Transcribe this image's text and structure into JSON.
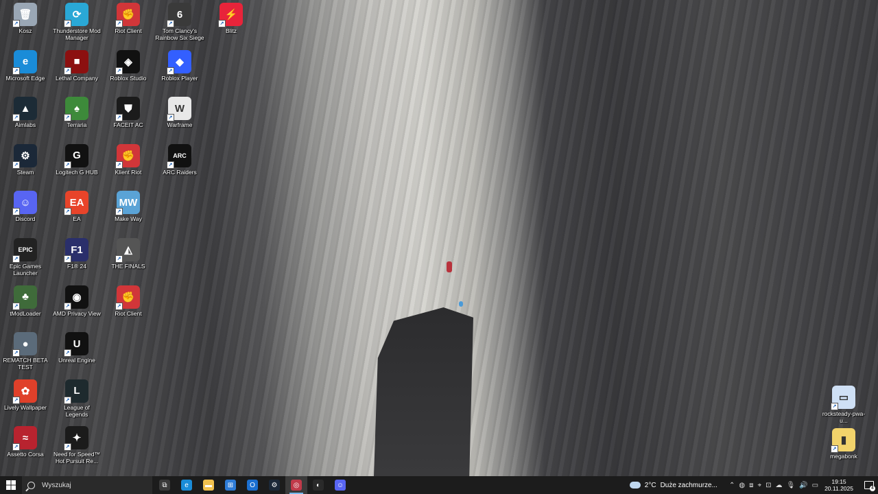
{
  "desktop_icons": [
    {
      "label": "Kosz",
      "icon": "recycle-bin-icon",
      "color": "#9aa7b5",
      "glyph": "🗑"
    },
    {
      "label": "Microsoft Edge",
      "icon": "edge-icon",
      "color": "#1a8cd8",
      "glyph": "e"
    },
    {
      "label": "Aimlabs",
      "icon": "aimlabs-icon",
      "color": "#1c2b36",
      "glyph": "▲"
    },
    {
      "label": "Steam",
      "icon": "steam-icon",
      "color": "#1b2838",
      "glyph": "⚙"
    },
    {
      "label": "Discord",
      "icon": "discord-icon",
      "color": "#5865f2",
      "glyph": "☺"
    },
    {
      "label": "Epic Games Launcher",
      "icon": "epic-games-icon",
      "color": "#222222",
      "glyph": "EPIC"
    },
    {
      "label": "tModLoader",
      "icon": "tmodloader-icon",
      "color": "#3f6b3a",
      "glyph": "♣"
    },
    {
      "label": "REMATCH BETA TEST",
      "icon": "rematch-icon",
      "color": "#5b6b7a",
      "glyph": "●"
    },
    {
      "label": "Lively Wallpaper",
      "icon": "lively-wallpaper-icon",
      "color": "#e0402a",
      "glyph": "✿"
    },
    {
      "label": "Assetto Corsa",
      "icon": "assetto-corsa-icon",
      "color": "#b8232f",
      "glyph": "≈"
    },
    {
      "label": "Thunderstore Mod Manager",
      "icon": "thunderstore-icon",
      "color": "#2aa8d6",
      "glyph": "⟳"
    },
    {
      "label": "Lethal Company",
      "icon": "lethal-company-icon",
      "color": "#8c1010",
      "glyph": "■"
    },
    {
      "label": "Terraria",
      "icon": "terraria-icon",
      "color": "#3d8a3a",
      "glyph": "♠"
    },
    {
      "label": "Logitech G HUB",
      "icon": "logitech-ghub-icon",
      "color": "#111111",
      "glyph": "G"
    },
    {
      "label": "EA",
      "icon": "ea-icon",
      "color": "#e8442a",
      "glyph": "EA"
    },
    {
      "label": "F1® 24",
      "icon": "f1-24-icon",
      "color": "#2a2f6b",
      "glyph": "F1"
    },
    {
      "label": "AMD Privacy View",
      "icon": "amd-privacy-view-icon",
      "color": "#111111",
      "glyph": "◉"
    },
    {
      "label": "Unreal Engine",
      "icon": "unreal-engine-icon",
      "color": "#111111",
      "glyph": "U"
    },
    {
      "label": "League of Legends",
      "icon": "league-of-legends-icon",
      "color": "#1e2a2e",
      "glyph": "L"
    },
    {
      "label": "Need for Speed™ Hot Pursuit Re...",
      "icon": "nfs-hot-pursuit-icon",
      "color": "#1b1b1b",
      "glyph": "✦"
    },
    {
      "label": "Riot Client",
      "icon": "riot-client-icon",
      "color": "#d13639",
      "glyph": "✊"
    },
    {
      "label": "Roblox Studio",
      "icon": "roblox-studio-icon",
      "color": "#111111",
      "glyph": "◈"
    },
    {
      "label": "FACEIT AC",
      "icon": "faceit-ac-icon",
      "color": "#1b1b1b",
      "glyph": "⛊"
    },
    {
      "label": "Klient Riot",
      "icon": "klient-riot-icon",
      "color": "#d13639",
      "glyph": "✊"
    },
    {
      "label": "Make Way",
      "icon": "make-way-icon",
      "color": "#5aa3d6",
      "glyph": "MW"
    },
    {
      "label": "THE FINALS",
      "icon": "the-finals-icon",
      "color": "#555555",
      "glyph": "◭"
    },
    {
      "label": "Riot Client",
      "icon": "riot-client-icon",
      "color": "#d13639",
      "glyph": "✊"
    },
    {
      "label": "Tom Clancy's Rainbow Six Siege",
      "icon": "rainbow-six-siege-icon",
      "color": "#3a3a3a",
      "glyph": "6"
    },
    {
      "label": "Roblox Player",
      "icon": "roblox-player-icon",
      "color": "#335fff",
      "glyph": "◆"
    },
    {
      "label": "Warframe",
      "icon": "warframe-icon",
      "color": "#e8e8e8",
      "glyph": "W"
    },
    {
      "label": "ARC Raiders",
      "icon": "arc-raiders-icon",
      "color": "#111111",
      "glyph": "ARC"
    },
    {
      "label": "Blitz",
      "icon": "blitz-icon",
      "color": "#e8243a",
      "glyph": "⚡"
    }
  ],
  "right_icons": [
    {
      "label": "rocksteady-pwa-u...",
      "icon": "image-file-icon",
      "color": "#cfe0f5",
      "glyph": "▭"
    },
    {
      "label": "megabonk",
      "icon": "folder-zip-icon",
      "color": "#f2d36b",
      "glyph": "▮"
    }
  ],
  "taskbar": {
    "search_placeholder": "Wyszukaj",
    "apps": [
      {
        "name": "task-view-icon",
        "color": "#3a3a3a",
        "glyph": "⧉"
      },
      {
        "name": "edge-taskbar-icon",
        "color": "#1a8cd8",
        "glyph": "e"
      },
      {
        "name": "file-explorer-icon",
        "color": "#f2c14e",
        "glyph": "▬"
      },
      {
        "name": "store-icon",
        "color": "#2e7bd6",
        "glyph": "⊞"
      },
      {
        "name": "outlook-icon",
        "color": "#1b6fd0",
        "glyph": "O"
      },
      {
        "name": "steam-taskbar-icon",
        "color": "#1b2838",
        "glyph": "⚙"
      },
      {
        "name": "riot-taskbar-icon",
        "color": "#c03a4a",
        "glyph": "◎"
      },
      {
        "name": "obs-icon",
        "color": "#2a2a2a",
        "glyph": "◐"
      },
      {
        "name": "discord-taskbar-icon",
        "color": "#5865f2",
        "glyph": "☺"
      }
    ],
    "weather": {
      "temperature": "2°C",
      "description": "Duże zachmurze..."
    },
    "time": "19:15",
    "date": "20.11.2025",
    "notification_count": "4"
  }
}
